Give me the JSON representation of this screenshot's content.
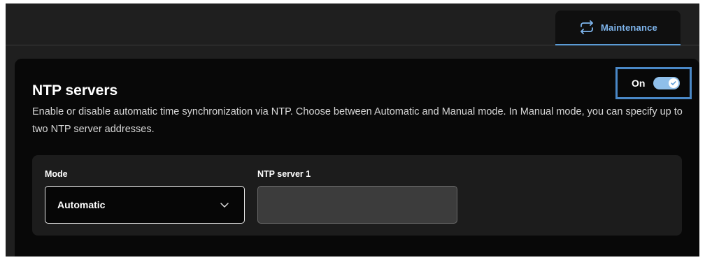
{
  "tabs": [
    {
      "label": "Maintenance",
      "icon": "repeat-icon",
      "active": true
    }
  ],
  "ntp": {
    "title": "NTP servers",
    "description": "Enable or disable automatic time synchronization via NTP. Choose between Automatic and Manual mode. In Manual mode, you can specify up to two NTP server addresses.",
    "toggle": {
      "label": "On",
      "enabled": true
    },
    "mode": {
      "label": "Mode",
      "value": "Automatic"
    },
    "server1": {
      "label": "NTP server 1",
      "value": "",
      "placeholder": ""
    }
  },
  "colors": {
    "accent": "#7fb6ee",
    "focus_outline": "#4a88c7",
    "card_bg": "#080808",
    "panel_bg": "#1c1c1c"
  }
}
